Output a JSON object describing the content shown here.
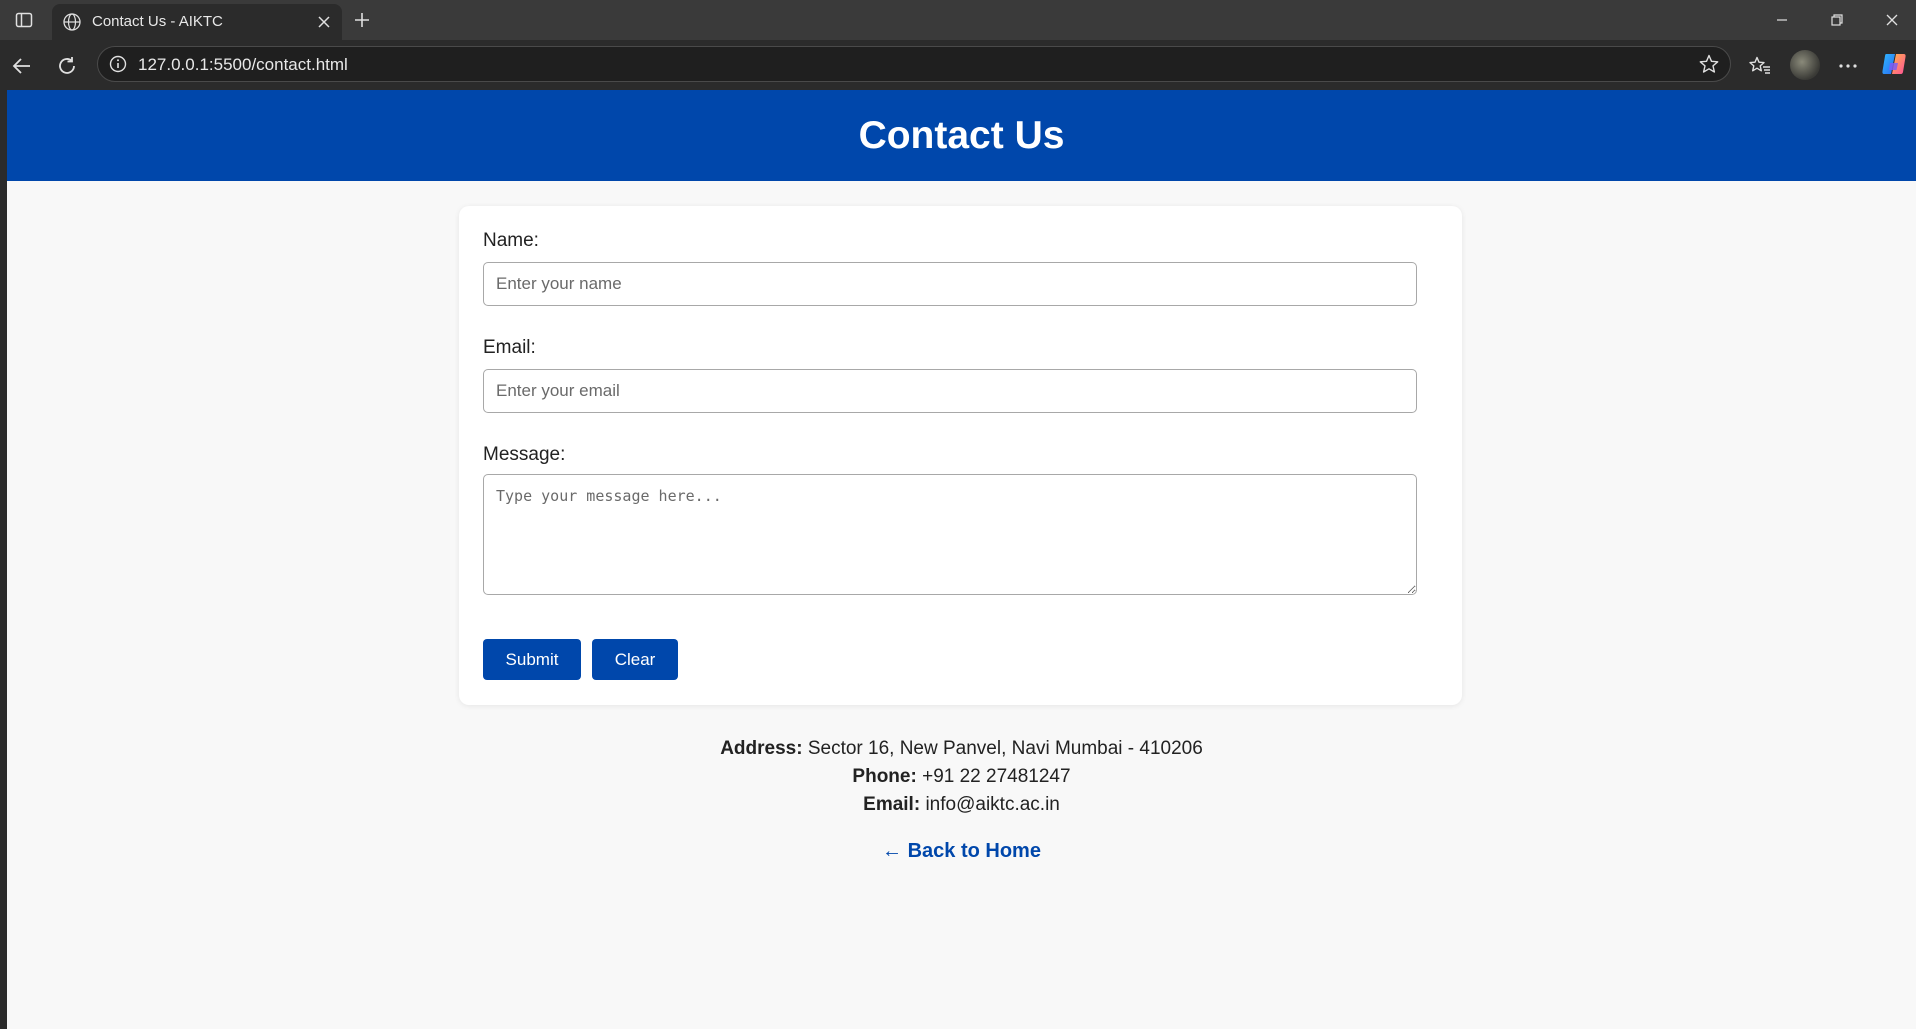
{
  "browser": {
    "tab_title": "Contact Us - AIKTC",
    "url": "127.0.0.1:5500/contact.html"
  },
  "page": {
    "title": "Contact Us",
    "form": {
      "name_label": "Name:",
      "name_placeholder": "Enter your name",
      "name_value": "",
      "email_label": "Email:",
      "email_placeholder": "Enter your email",
      "email_value": "",
      "message_label": "Message:",
      "message_placeholder": "Type your message here...",
      "message_value": "",
      "submit_label": "Submit",
      "clear_label": "Clear"
    },
    "contact": {
      "address_label": "Address:",
      "address_value": "Sector 16, New Panvel, Navi Mumbai - 410206",
      "phone_label": "Phone:",
      "phone_value": "+91 22 27481247",
      "email_label": "Email:",
      "email_value": "info@aiktc.ac.in"
    },
    "back_link": "← Back to Home"
  },
  "colors": {
    "brand": "#0047ab",
    "page_background": "#f8f8f8",
    "card_background": "#ffffff"
  },
  "icons": {
    "sidebar": "sidebar-toggle-icon",
    "favicon": "globe-icon",
    "close": "close-icon",
    "new_tab": "plus-icon",
    "back": "arrow-left-icon",
    "reload": "reload-icon",
    "info": "info-icon",
    "favorite": "star-icon",
    "favorites": "favorites-icon",
    "menu": "more-icon"
  }
}
